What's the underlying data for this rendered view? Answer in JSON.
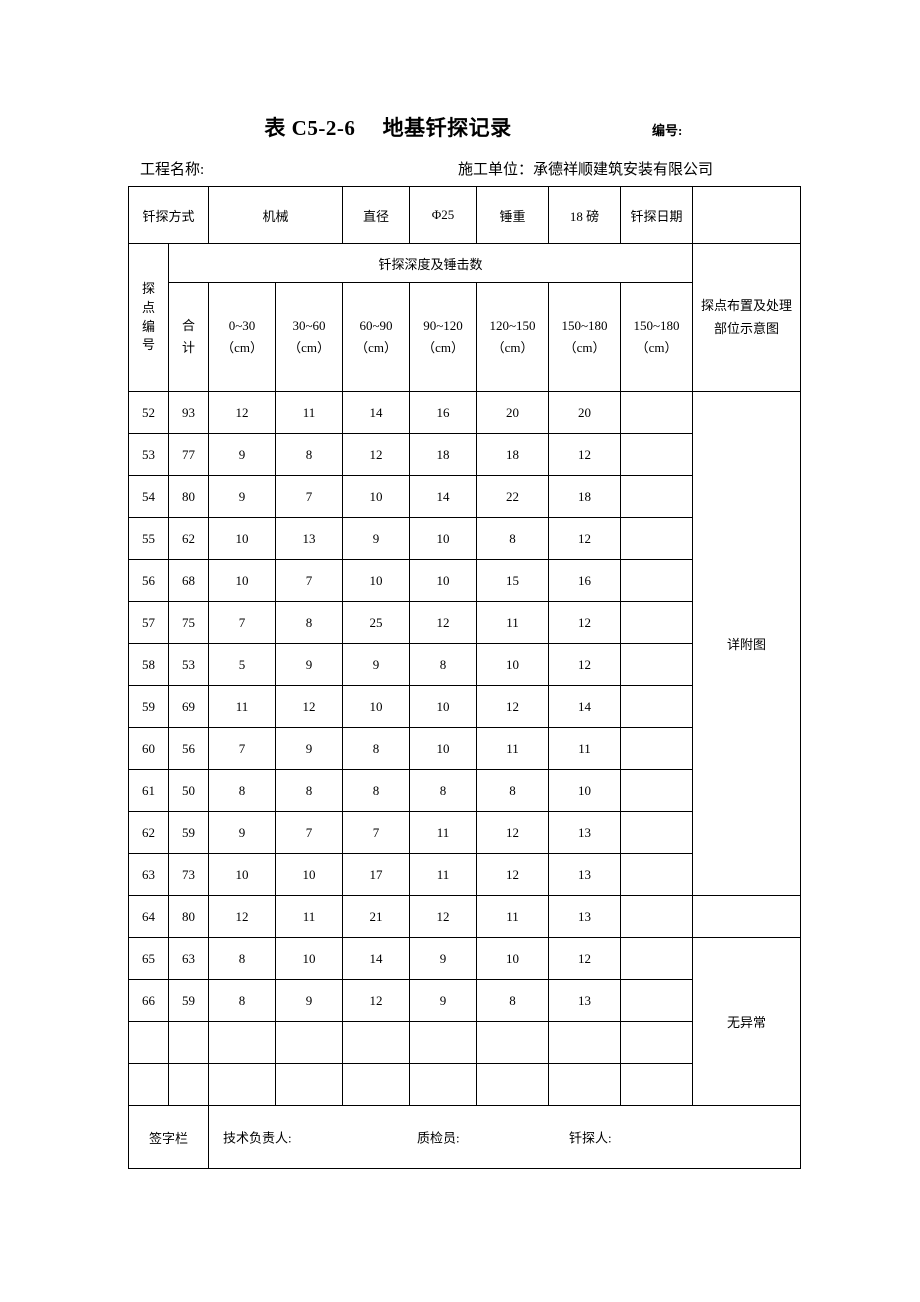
{
  "document": {
    "title": "表 C5-2-6　 地基钎探记录",
    "number_label": "编号:",
    "project_name_label": "工程名称:",
    "construction_unit": "施工单位：承德祥顺建筑安装有限公司"
  },
  "info_row": {
    "method_label": "钎探方式",
    "method_value": "机械",
    "diameter_label": "直径",
    "diameter_value": "Φ25",
    "hammer_label": "锤重",
    "hammer_value": "18 磅",
    "date_label": "钎探日期",
    "date_value": ""
  },
  "table_header": {
    "point_no": "探点编号",
    "point_no_chars": [
      "探",
      "点",
      "编",
      "号"
    ],
    "depth_group": "钎探深度及锤击数",
    "total_chars": [
      "合",
      "计"
    ],
    "unit": "（cm）",
    "depth_ranges": [
      "0~30",
      "30~60",
      "60~90",
      "90~120",
      "120~150",
      "150~180",
      "150~180"
    ],
    "diagram_label_line1": "探点布置及处理",
    "diagram_label_line2": "部位示意图"
  },
  "rows": [
    {
      "no": "52",
      "total": "93",
      "d": [
        "12",
        "11",
        "14",
        "16",
        "20",
        "20"
      ]
    },
    {
      "no": "53",
      "total": "77",
      "d": [
        "9",
        "8",
        "12",
        "18",
        "18",
        "12"
      ]
    },
    {
      "no": "54",
      "total": "80",
      "d": [
        "9",
        "7",
        "10",
        "14",
        "22",
        "18"
      ]
    },
    {
      "no": "55",
      "total": "62",
      "d": [
        "10",
        "13",
        "9",
        "10",
        "8",
        "12"
      ]
    },
    {
      "no": "56",
      "total": "68",
      "d": [
        "10",
        "7",
        "10",
        "10",
        "15",
        "16"
      ]
    },
    {
      "no": "57",
      "total": "75",
      "d": [
        "7",
        "8",
        "25",
        "12",
        "11",
        "12"
      ]
    },
    {
      "no": "58",
      "total": "53",
      "d": [
        "5",
        "9",
        "9",
        "8",
        "10",
        "12"
      ]
    },
    {
      "no": "59",
      "total": "69",
      "d": [
        "11",
        "12",
        "10",
        "10",
        "12",
        "14"
      ]
    },
    {
      "no": "60",
      "total": "56",
      "d": [
        "7",
        "9",
        "8",
        "10",
        "11",
        "11"
      ]
    },
    {
      "no": "61",
      "total": "50",
      "d": [
        "8",
        "8",
        "8",
        "8",
        "8",
        "10"
      ]
    },
    {
      "no": "62",
      "total": "59",
      "d": [
        "9",
        "7",
        "7",
        "11",
        "12",
        "13"
      ]
    },
    {
      "no": "63",
      "total": "73",
      "d": [
        "10",
        "10",
        "17",
        "11",
        "12",
        "13"
      ]
    },
    {
      "no": "64",
      "total": "80",
      "d": [
        "12",
        "11",
        "21",
        "12",
        "11",
        "13"
      ]
    },
    {
      "no": "65",
      "total": "63",
      "d": [
        "8",
        "10",
        "14",
        "9",
        "10",
        "12"
      ]
    },
    {
      "no": "66",
      "total": "59",
      "d": [
        "8",
        "9",
        "12",
        "9",
        "8",
        "13"
      ]
    },
    {
      "no": "",
      "total": "",
      "d": [
        "",
        "",
        "",
        "",
        "",
        ""
      ]
    },
    {
      "no": "",
      "total": "",
      "d": [
        "",
        "",
        "",
        "",
        "",
        ""
      ]
    }
  ],
  "notes": {
    "block1": "详附图",
    "block2": "",
    "block3": "无异常"
  },
  "signature": {
    "label": "签字栏",
    "technical_lead": "技术负责人:",
    "inspector": "质检员:",
    "prober": "钎探人:"
  }
}
